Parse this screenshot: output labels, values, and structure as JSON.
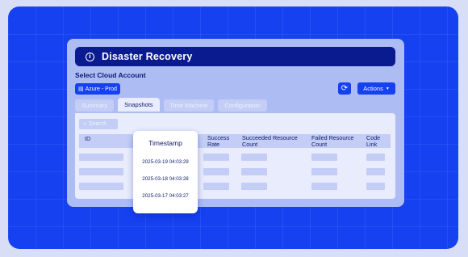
{
  "window": {
    "title": "Disaster Recovery",
    "info_icon": "info-icon"
  },
  "section": {
    "select_account_label": "Select Cloud Account"
  },
  "account": {
    "selected": "Azure - Prod",
    "icon": "cloud-account-icon"
  },
  "toolbar": {
    "refresh_icon": "refresh-icon",
    "actions_label": "Actions"
  },
  "tabs": [
    {
      "label": "Summary",
      "active": false
    },
    {
      "label": "Snapshots",
      "active": true
    },
    {
      "label": "Time Machine",
      "active": false
    },
    {
      "label": "Configuration",
      "active": false
    }
  ],
  "search": {
    "placeholder": "Search"
  },
  "table": {
    "columns": {
      "id": "ID",
      "success_rate": "Success\nRate",
      "succeeded": "Succeeded Resource\nCount",
      "failed": "Failed Resource\nCount",
      "code_link": "Code\nLink"
    },
    "row_count": 3
  },
  "timestamp_popup": {
    "title": "Timestamp",
    "values": [
      "2025-03-19 04:03:29",
      "2025-03-18 04:03:28",
      "2025-03-17 04:03:27"
    ]
  },
  "colors": {
    "brand_blue": "#1541f0",
    "navy": "#0a1a8f",
    "panel": "#aebcf4",
    "surface": "#e8ecfc"
  }
}
